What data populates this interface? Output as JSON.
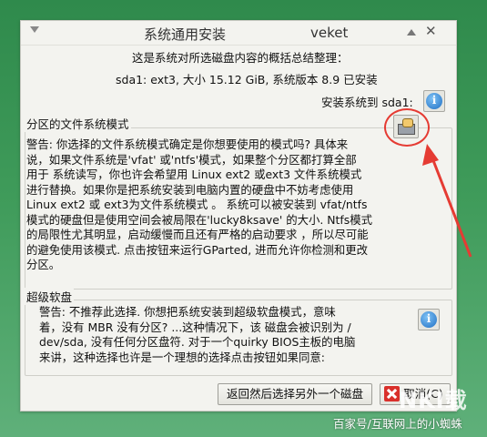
{
  "window": {
    "title": "系统通用安装",
    "app_name": "veket",
    "close_symbol": "✕"
  },
  "summary": {
    "intro": "这是系统对所选磁盘内容的概括总结整理：",
    "info": "sda1: ext3, 大小 15.12 GiB, 系统版本 8.9 已安装",
    "install_label": "安装系统到 sda1:",
    "install_icon": "info-icon"
  },
  "partition_group": {
    "title": "分区的文件系统模式",
    "lines": [
      "警告: 你选择的文件系统模式确定是你想要使用的模式吗? 具体来",
      "说，如果文件系统是'vfat' 或'ntfs'模式，如果整个分区都打算全部",
      "用于 系统读写，你也许会希望用 Linux ext2 或ext3 文件系统模式",
      "进行替换。如果你是把系统安装到电脑内置的硬盘中不妨考虑使用",
      "Linux ext2 或 ext3为文件系统模式 。 系统可以被安装到 vfat/ntfs",
      "模式的硬盘但是使用空间会被局限在'lucky8ksave' 的大小. Ntfs模式",
      "的局限性尤其明显，启动缓慢而且还有严格的启动要求 ，所以尽可能",
      "的避免使用该模式. 点击按钮来运行GParted, 进而允许你检测和更改",
      "分区。"
    ],
    "gparted_icon": "gparted-icon",
    "highlight_color": "#e53b33"
  },
  "super_floppy_group": {
    "title": "超级软盘",
    "lines": [
      "警告: 不推荐此选择. 你想把系统安装到超级软盘模式，意味",
      "着，没有 MBR 没有分区? ...这种情况下，该 磁盘会被识别为 /",
      "dev/sda, 没有任何分区盘符. 对于一个quirky BIOS主板的电脑",
      "来讲，这种选择也许是一个理想的选择点击按钮如果同意:"
    ],
    "info_icon": "info-icon"
  },
  "buttons": {
    "back_label": "返回然后选择另外一个磁盘",
    "cancel_label": "取消(C)"
  },
  "watermark": {
    "logo": "NKI载",
    "credit": "百家号/互联网上的小蜘蛛"
  }
}
